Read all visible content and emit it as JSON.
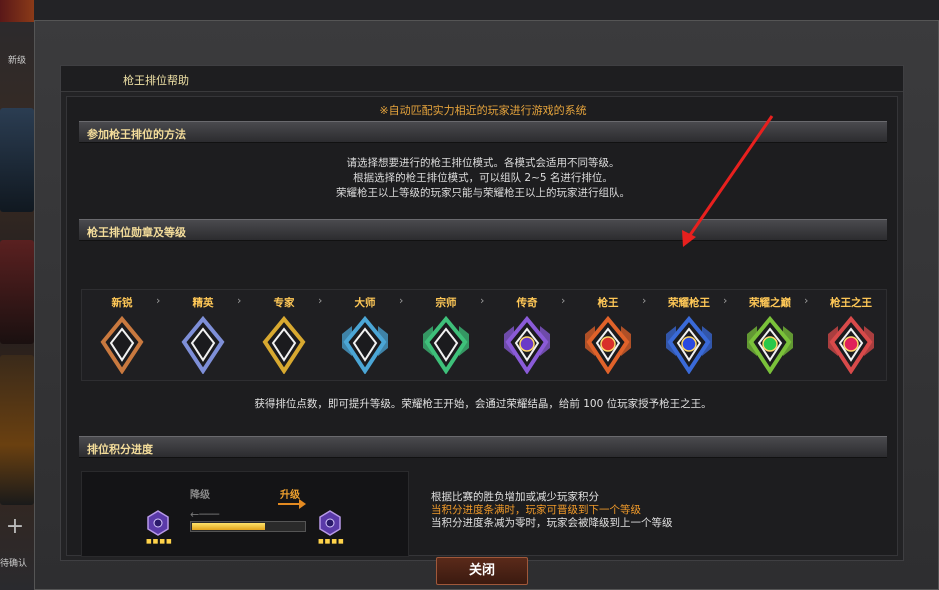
{
  "background": {
    "left_tab_label": "新级",
    "left_confirm_label": "待确认",
    "plus_symbol": "+"
  },
  "dialog": {
    "title": "枪王排位帮助",
    "notice": "※自动匹配实力相近的玩家进行游戏的系统",
    "close_label": "关闭"
  },
  "section_how": {
    "header": "参加枪王排位的方法",
    "lines": [
      "请选择想要进行的枪王排位模式。各模式会适用不同等级。",
      "根据选择的枪王排位模式，可以组队 2~5 名进行排位。",
      "荣耀枪王以上等级的玩家只能与荣耀枪王以上的玩家进行组队。"
    ]
  },
  "section_ranks": {
    "header": "枪王排位勋章及等级",
    "chevron": "›",
    "ranks": [
      {
        "name": "新锐",
        "color": "#c9793f",
        "gem": ""
      },
      {
        "name": "精英",
        "color": "#7e8fd8",
        "gem": ""
      },
      {
        "name": "专家",
        "color": "#d8a930",
        "gem": ""
      },
      {
        "name": "大师",
        "color": "#4ba6d6",
        "gem": ""
      },
      {
        "name": "宗师",
        "color": "#3ec07a",
        "gem": ""
      },
      {
        "name": "传奇",
        "color": "#8a5bd8",
        "gem": "#6a3ac8"
      },
      {
        "name": "枪王",
        "color": "#e0622a",
        "gem": "#d8302a"
      },
      {
        "name": "荣耀枪王",
        "color": "#3a6ad8",
        "gem": "#2a4ae0"
      },
      {
        "name": "荣耀之巅",
        "color": "#7ac13a",
        "gem": "#2ac84a"
      },
      {
        "name": "枪王之王",
        "color": "#d84a4a",
        "gem": "#e0205a"
      }
    ],
    "description": "获得排位点数，即可提升等级。荣耀枪王开始，会通过荣耀结晶，给前 100 位玩家授予枪王之王。"
  },
  "section_progress": {
    "header": "排位积分进度",
    "down_label": "降级",
    "up_label": "升级",
    "progress_fraction": 0.65,
    "text_lines": [
      "根据比赛的胜负增加或减少玩家积分",
      "当积分进度条满时，玩家可晋级到下一个等级",
      "当积分进度条减为零时，玩家会被降级到上一个等级"
    ],
    "highlight_color": "#f09a2a"
  }
}
